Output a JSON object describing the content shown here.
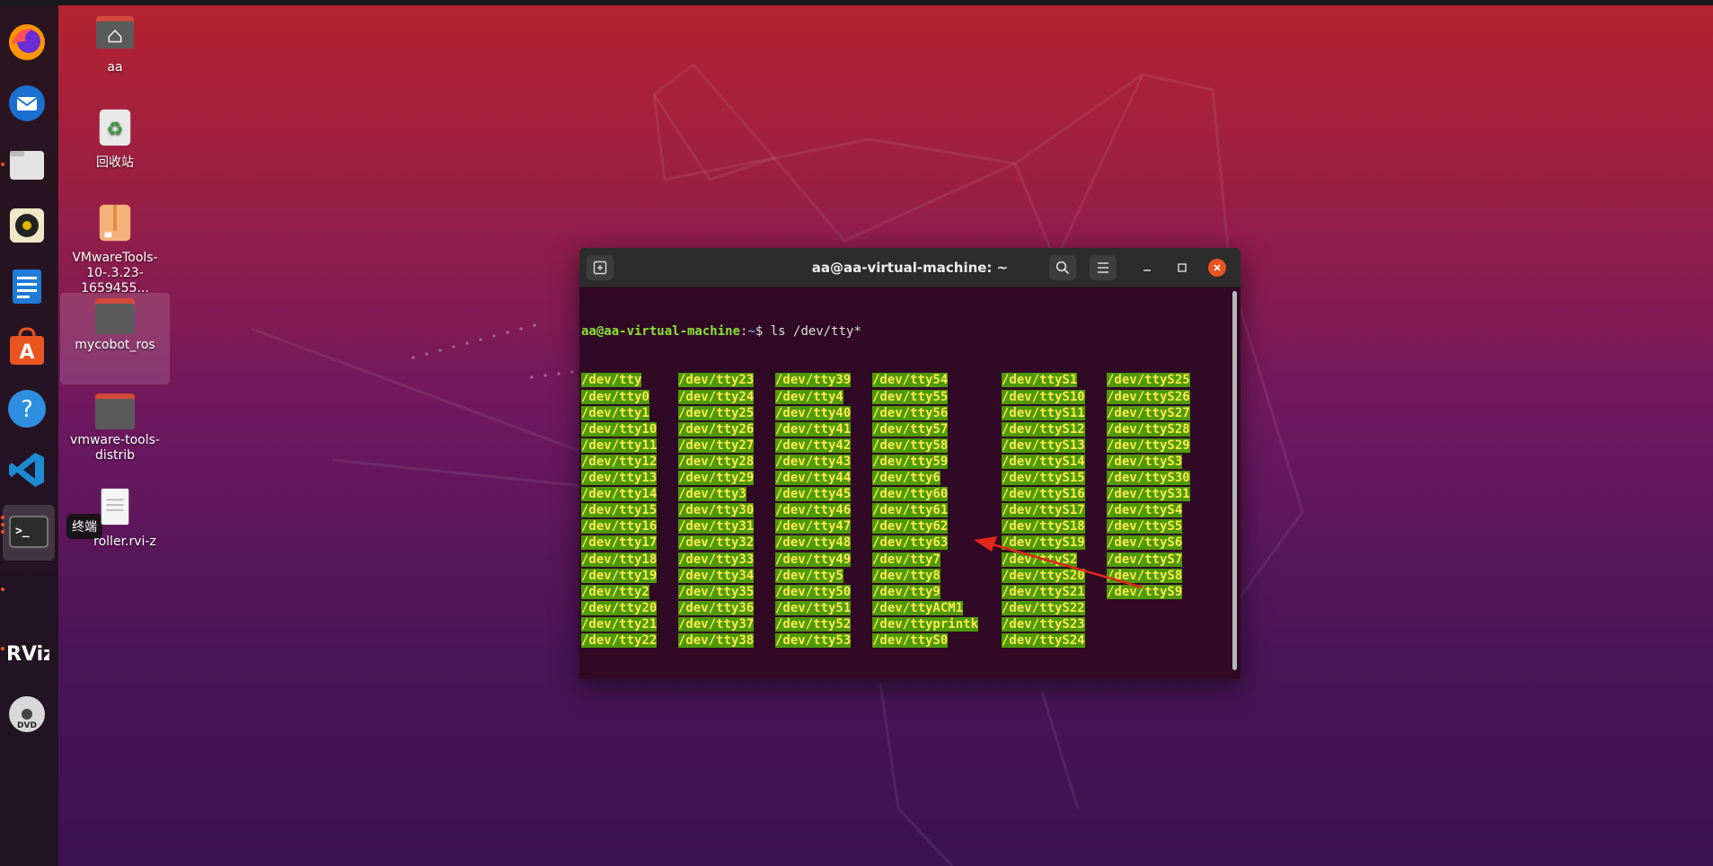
{
  "desktop": {
    "icons": [
      {
        "label": "aa",
        "icon": "home-folder-icon"
      },
      {
        "label": "回收站",
        "icon": "trash-icon"
      },
      {
        "label": "VMwareTools-10-.3.23-1659455...",
        "icon": "archive-icon"
      },
      {
        "label": "mycobot_ros",
        "icon": "folder-icon"
      },
      {
        "label": "vmware-tools-distrib",
        "icon": "folder-icon"
      },
      {
        "label": "roller.rvi-z",
        "icon": "document-icon"
      }
    ]
  },
  "dock": {
    "items": [
      {
        "name": "firefox",
        "icon": "firefox-icon"
      },
      {
        "name": "thunderbird",
        "icon": "thunderbird-icon"
      },
      {
        "name": "files",
        "icon": "files-icon"
      },
      {
        "name": "rhythmbox",
        "icon": "rhythmbox-icon"
      },
      {
        "name": "libreoffice-writer",
        "icon": "writer-icon"
      },
      {
        "name": "software",
        "icon": "software-center-icon"
      },
      {
        "name": "help",
        "icon": "help-icon"
      },
      {
        "name": "vscode",
        "icon": "vscode-icon"
      },
      {
        "name": "terminal",
        "icon": "terminal-icon"
      },
      {
        "name": "rviz",
        "icon": "rviz-icon"
      },
      {
        "name": "dvd",
        "icon": "dvd-icon"
      }
    ],
    "tooltip": "终端",
    "rviz_label": "RViz",
    "dvd_label": "DVD"
  },
  "terminal": {
    "title": "aa@aa-virtual-machine: ~",
    "prompt_user": "aa@aa-virtual-machine",
    "prompt_sep": ":",
    "prompt_path": "~",
    "prompt_symbol": "$",
    "command": " ls /dev/tty*",
    "columns": [
      [
        "/dev/tty",
        "/dev/tty0",
        "/dev/tty1",
        "/dev/tty10",
        "/dev/tty11",
        "/dev/tty12",
        "/dev/tty13",
        "/dev/tty14",
        "/dev/tty15",
        "/dev/tty16",
        "/dev/tty17",
        "/dev/tty18",
        "/dev/tty19",
        "/dev/tty2",
        "/dev/tty20",
        "/dev/tty21",
        "/dev/tty22"
      ],
      [
        "/dev/tty23",
        "/dev/tty24",
        "/dev/tty25",
        "/dev/tty26",
        "/dev/tty27",
        "/dev/tty28",
        "/dev/tty29",
        "/dev/tty3",
        "/dev/tty30",
        "/dev/tty31",
        "/dev/tty32",
        "/dev/tty33",
        "/dev/tty34",
        "/dev/tty35",
        "/dev/tty36",
        "/dev/tty37",
        "/dev/tty38"
      ],
      [
        "/dev/tty39",
        "/dev/tty4",
        "/dev/tty40",
        "/dev/tty41",
        "/dev/tty42",
        "/dev/tty43",
        "/dev/tty44",
        "/dev/tty45",
        "/dev/tty46",
        "/dev/tty47",
        "/dev/tty48",
        "/dev/tty49",
        "/dev/tty5",
        "/dev/tty50",
        "/dev/tty51",
        "/dev/tty52",
        "/dev/tty53"
      ],
      [
        "/dev/tty54",
        "/dev/tty55",
        "/dev/tty56",
        "/dev/tty57",
        "/dev/tty58",
        "/dev/tty59",
        "/dev/tty6",
        "/dev/tty60",
        "/dev/tty61",
        "/dev/tty62",
        "/dev/tty63",
        "/dev/tty7",
        "/dev/tty8",
        "/dev/tty9",
        "/dev/ttyACM1",
        "/dev/ttyprintk",
        "/dev/ttyS0"
      ],
      [
        "/dev/ttyS1",
        "/dev/ttyS10",
        "/dev/ttyS11",
        "/dev/ttyS12",
        "/dev/ttyS13",
        "/dev/ttyS14",
        "/dev/ttyS15",
        "/dev/ttyS16",
        "/dev/ttyS17",
        "/dev/ttyS18",
        "/dev/ttyS19",
        "/dev/ttyS2",
        "/dev/ttyS20",
        "/dev/ttyS21",
        "/dev/ttyS22",
        "/dev/ttyS23",
        "/dev/ttyS24"
      ],
      [
        "/dev/ttyS25",
        "/dev/ttyS26",
        "/dev/ttyS27",
        "/dev/ttyS28",
        "/dev/ttyS29",
        "/dev/ttyS3",
        "/dev/ttyS30",
        "/dev/ttyS31",
        "/dev/ttyS4",
        "/dev/ttyS5",
        "/dev/ttyS6",
        "/dev/ttyS7",
        "/dev/ttyS8",
        "/dev/ttyS9"
      ]
    ],
    "colors": {
      "bg": "#300a24",
      "user": "#8ae234",
      "path": "#729fcf",
      "highlight_bg": "#4e9a06",
      "highlight_fg": "#fce94f"
    }
  },
  "annotation": {
    "color": "#e3261c"
  }
}
